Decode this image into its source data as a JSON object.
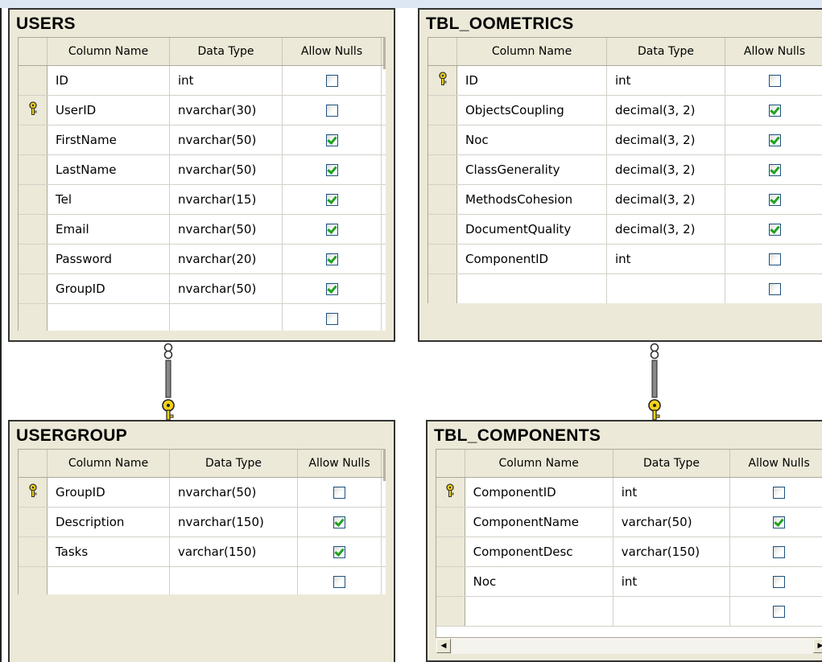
{
  "headers": {
    "column_name": "Column Name",
    "data_type": "Data Type",
    "allow_nulls": "Allow Nulls"
  },
  "tables": {
    "users": {
      "title": "USERS",
      "rows": [
        {
          "name": "ID",
          "type": "int",
          "nulls": false,
          "key": false
        },
        {
          "name": "UserID",
          "type": "nvarchar(30)",
          "nulls": false,
          "key": true
        },
        {
          "name": "FirstName",
          "type": "nvarchar(50)",
          "nulls": true,
          "key": false
        },
        {
          "name": "LastName",
          "type": "nvarchar(50)",
          "nulls": true,
          "key": false
        },
        {
          "name": "Tel",
          "type": "nvarchar(15)",
          "nulls": true,
          "key": false
        },
        {
          "name": "Email",
          "type": "nvarchar(50)",
          "nulls": true,
          "key": false
        },
        {
          "name": "Password",
          "type": "nvarchar(20)",
          "nulls": true,
          "key": false
        },
        {
          "name": "GroupID",
          "type": "nvarchar(50)",
          "nulls": true,
          "key": false
        },
        {
          "name": "",
          "type": "",
          "nulls": false,
          "key": false
        }
      ]
    },
    "tbl_oometrics": {
      "title": "TBL_OOMETRICS",
      "rows": [
        {
          "name": "ID",
          "type": "int",
          "nulls": false,
          "key": true
        },
        {
          "name": "ObjectsCoupling",
          "type": "decimal(3, 2)",
          "nulls": true,
          "key": false
        },
        {
          "name": "Noc",
          "type": "decimal(3, 2)",
          "nulls": true,
          "key": false
        },
        {
          "name": "ClassGenerality",
          "type": "decimal(3, 2)",
          "nulls": true,
          "key": false
        },
        {
          "name": "MethodsCohesion",
          "type": "decimal(3, 2)",
          "nulls": true,
          "key": false
        },
        {
          "name": "DocumentQuality",
          "type": "decimal(3, 2)",
          "nulls": true,
          "key": false
        },
        {
          "name": "ComponentID",
          "type": "int",
          "nulls": false,
          "key": false
        },
        {
          "name": "",
          "type": "",
          "nulls": false,
          "key": false
        }
      ]
    },
    "usergroup": {
      "title": "USERGROUP",
      "rows": [
        {
          "name": "GroupID",
          "type": "nvarchar(50)",
          "nulls": false,
          "key": true
        },
        {
          "name": "Description",
          "type": "nvarchar(150)",
          "nulls": true,
          "key": false
        },
        {
          "name": "Tasks",
          "type": "varchar(150)",
          "nulls": true,
          "key": false
        },
        {
          "name": "",
          "type": "",
          "nulls": false,
          "key": false
        }
      ]
    },
    "tbl_components": {
      "title": "TBL_COMPONENTS",
      "rows": [
        {
          "name": "ComponentID",
          "type": "int",
          "nulls": false,
          "key": true
        },
        {
          "name": "ComponentName",
          "type": "varchar(50)",
          "nulls": true,
          "key": false
        },
        {
          "name": "ComponentDesc",
          "type": "varchar(150)",
          "nulls": false,
          "key": false
        },
        {
          "name": "Noc",
          "type": "int",
          "nulls": false,
          "key": false
        },
        {
          "name": "",
          "type": "",
          "nulls": false,
          "key": false
        }
      ]
    }
  },
  "colors": {
    "panel": "#ece9d8",
    "border": "#333333",
    "check": "#21a121",
    "key": "#f2d21b"
  }
}
